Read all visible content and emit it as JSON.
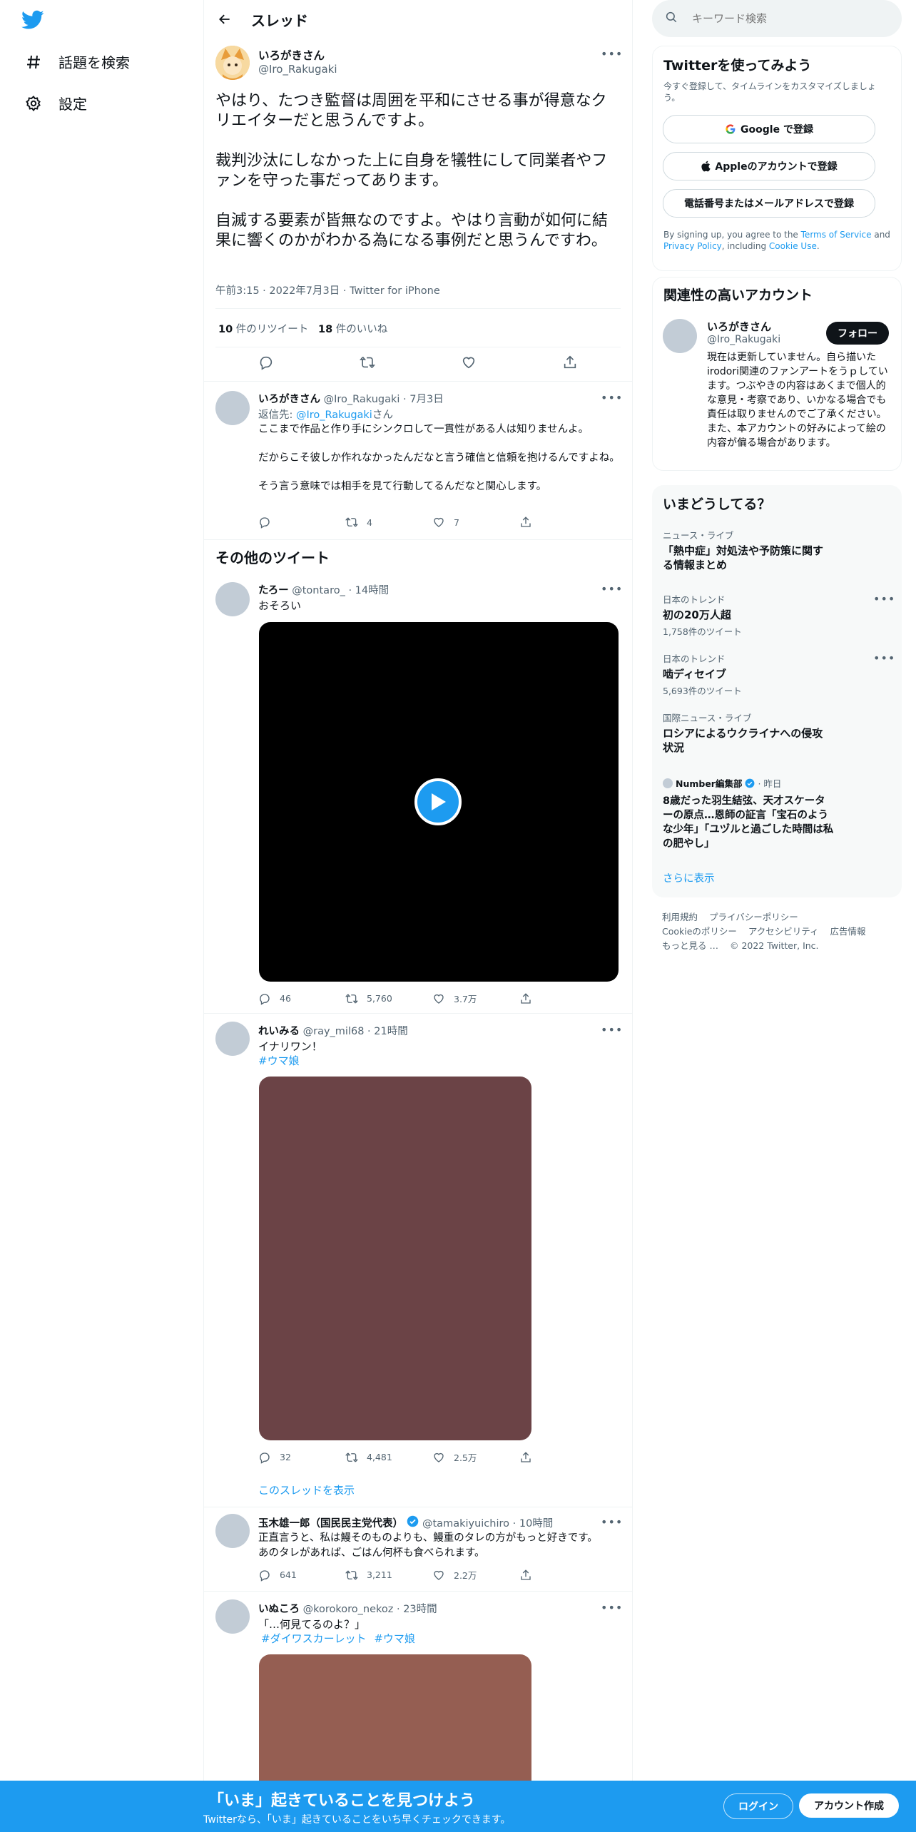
{
  "nav": {
    "items": [
      {
        "label": "話題を検索",
        "icon": "hashtag-icon"
      },
      {
        "label": "設定",
        "icon": "gear-icon"
      }
    ]
  },
  "header": {
    "title": "スレッド"
  },
  "main_tweet": {
    "name": "いろがきさん",
    "handle": "@Iro_Rakugaki",
    "paragraphs": [
      "やはり、たつき監督は周囲を平和にさせる事が得意なクリエイターだと思うんですよ。",
      "裁判沙汰にしなかった上に自身を犠牲にして同業者やファンを守った事だってあります。",
      "自滅する要素が皆無なのですよ。やはり言動が如何に結果に響くのかがわかる為になる事例だと思うんですわ。"
    ],
    "timestamp": "午前3:15 · 2022年7月3日 · Twitter for iPhone",
    "retweets_count": "10",
    "retweets_label": "件のリツイート",
    "likes_count": "18",
    "likes_label": "件のいいね"
  },
  "reply": {
    "name": "いろがきさん",
    "meta": "@Iro_Rakugaki · 7月3日",
    "reply_to_prefix": "返信先: ",
    "reply_to_handle": "@Iro_Rakugaki",
    "reply_to_suffix": "さん",
    "lines": [
      "ここまで作品と作り手にシンクロして一貫性がある人は知りませんよ。",
      "だからこそ彼しか作れなかったんだなと言う確信と信頼を抱けるんですよね。",
      "そう言う意味では相手を見て行動してるんだなと関心します。"
    ],
    "retweets": "4",
    "likes": "7"
  },
  "other_section_title": "その他のツイート",
  "tweets": [
    {
      "name": "たろー",
      "meta": "@tontaro_ · 14時間",
      "text": "おそろい",
      "replies": "46",
      "retweets": "5,760",
      "likes": "3.7万"
    },
    {
      "name": "れいみる",
      "meta": "@ray_mil68 · 21時間",
      "text": "イナリワン！",
      "hashtag": "#ウマ娘",
      "replies": "32",
      "retweets": "4,481",
      "likes": "2.5万",
      "show_thread": "このスレッドを表示"
    },
    {
      "name": "玉木雄一郎（国民民主党代表）",
      "meta": "@tamakiyuichiro · 10時間",
      "lines": [
        "正直言うと、私は鰻そのものよりも、鰻重のタレの方がもっと好きです。",
        "あのタレがあれば、ごはん何杯も食べられます。"
      ],
      "replies": "641",
      "retweets": "3,211",
      "likes": "2.2万"
    },
    {
      "name": "いぬころ",
      "meta": "@korokoro_nekoz · 23時間",
      "text": "「…何見てるのよ？」",
      "hashtags": [
        "#ダイワスカーレット",
        "#ウマ娘"
      ]
    }
  ],
  "search": {
    "placeholder": "キーワード検索"
  },
  "signup_panel": {
    "title": "Twitterを使ってみよう",
    "subtitle": "今すぐ登録して、タイムラインをカスタマイズしましょう。",
    "google_btn": "Google で登録",
    "apple_btn": "Appleのアカウントで登録",
    "phone_btn": "電話番号またはメールアドレスで登録",
    "terms_pre": "By signing up, you agree to the ",
    "terms_link": "Terms of Service",
    "terms_and": " and ",
    "privacy_link": "Privacy Policy",
    "terms_mid": ", including ",
    "cookie_link": "Cookie Use",
    "terms_end": "."
  },
  "related": {
    "title": "関連性の高いアカウント",
    "name": "いろがきさん",
    "handle": "@Iro_Rakugaki",
    "follow_btn": "フォロー",
    "bio": "現在は更新していません。自ら描いたirodori関連のファンアートをうｐしています。つぶやきの内容はあくまで個人的な意見・考察であり、いかなる場合でも責任は取りませんのでご了承ください。また、本アカウントの好みによって絵の内容が偏る場合があります。"
  },
  "trends": {
    "title": "いまどうしてる？",
    "items": [
      {
        "category": "ニュース・ライブ",
        "title": "「熱中症」対処法や予防策に関する情報まとめ"
      },
      {
        "category": "日本のトレンド",
        "title": "初の20万人超",
        "count": "1,758件のツイート"
      },
      {
        "category": "日本のトレンド",
        "title": "啮ディセイブ",
        "count": "5,693件のツイート"
      },
      {
        "category": "国際ニュース・ライブ",
        "title": "ロシアによるウクライナへの侵攻状況"
      },
      {
        "source": "Number編集部",
        "time": "· 昨日",
        "title": "8歳だった羽生結弦、天才スケーターの原点…恩師の証言「宝石のような少年」「ユヅルと過ごした時間は私の肥やし」"
      }
    ],
    "show_more": "さらに表示"
  },
  "footer": {
    "links_row1": [
      "利用規約",
      "プライバシーポリシー"
    ],
    "links_row2": [
      "Cookieのポリシー",
      "アクセシビリティ",
      "広告情報"
    ],
    "more": "もっと見る …",
    "copyright": "© 2022 Twitter, Inc."
  },
  "bottom_bar": {
    "title": "「いま」起きていることを見つけよう",
    "subtitle": "Twitterなら、「いま」起きていることをいち早くチェックできます。",
    "login": "ログイン",
    "signup": "アカウント作成"
  },
  "colors": {
    "accent": "#1d9bf0",
    "image1": "#6b4346",
    "image2": "#955e52",
    "video": "#000000"
  }
}
